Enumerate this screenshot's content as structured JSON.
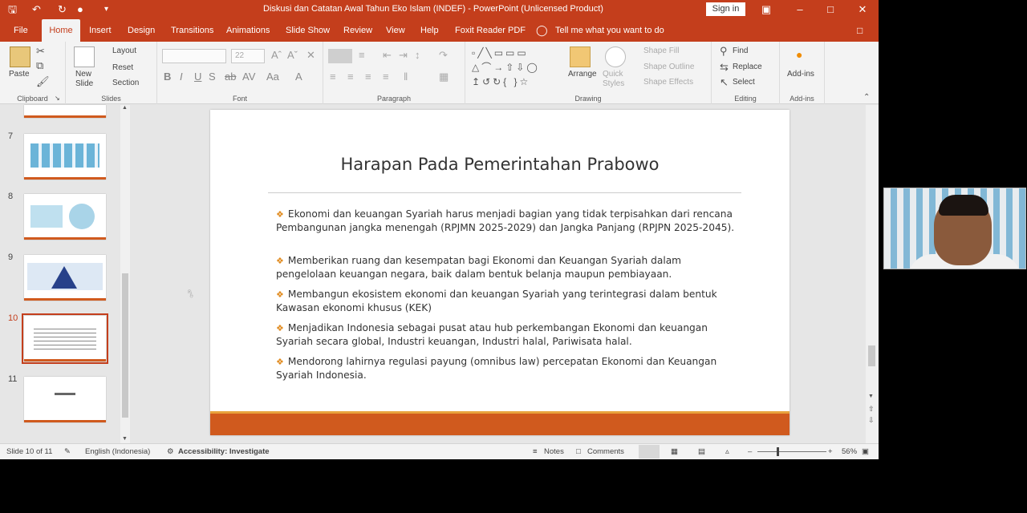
{
  "window": {
    "title": "Diskusi dan Catatan Awal Tahun Eko Islam (INDEF) - PowerPoint (Unlicensed Product)",
    "sign_in": "Sign in",
    "tell_me": "Tell me what you want to do"
  },
  "tabs": [
    "File",
    "Home",
    "Insert",
    "Design",
    "Transitions",
    "Animations",
    "Slide Show",
    "Review",
    "View",
    "Help",
    "Foxit Reader PDF"
  ],
  "ribbon": {
    "clipboard": {
      "label": "Clipboard",
      "paste": "Paste"
    },
    "slides": {
      "label": "Slides",
      "new_slide": "New Slide",
      "layout": "Layout",
      "reset": "Reset",
      "section": "Section"
    },
    "font": {
      "label": "Font",
      "size": "22"
    },
    "paragraph": {
      "label": "Paragraph"
    },
    "drawing": {
      "label": "Drawing",
      "arrange": "Arrange",
      "quick_styles": "Quick Styles",
      "shape_fill": "Shape Fill",
      "shape_outline": "Shape Outline",
      "shape_effects": "Shape Effects"
    },
    "editing": {
      "label": "Editing",
      "find": "Find",
      "replace": "Replace",
      "select": "Select"
    },
    "addins": {
      "label": "Add-ins",
      "button": "Add-ins"
    }
  },
  "thumbnails": [
    {
      "number": "7",
      "active": false
    },
    {
      "number": "8",
      "active": false
    },
    {
      "number": "9",
      "active": false
    },
    {
      "number": "10",
      "active": true
    },
    {
      "number": "11",
      "active": false
    }
  ],
  "slide": {
    "title": "Harapan Pada Pemerintahan Prabowo",
    "bullets": [
      "Ekonomi dan keuangan Syariah harus menjadi bagian yang tidak terpisahkan dari rencana Pembangunan jangka menengah (RPJMN 2025-2029) dan Jangka Panjang (RPJPN 2025-2045).",
      "Memberikan ruang dan kesempatan bagi Ekonomi dan Keuangan Syariah dalam pengelolaan keuangan negara, baik dalam bentuk belanja maupun pembiayaan.",
      "Membangun ekosistem ekonomi dan keuangan Syariah yang terintegrasi dalam bentuk Kawasan ekonomi khusus (KEK)",
      "Menjadikan Indonesia sebagai pusat atau hub perkembangan Ekonomi dan keuangan Syariah secara global, Industri keuangan, Industri halal, Pariwisata halal.",
      "Mendorong lahirnya regulasi payung (omnibus law) percepatan Ekonomi dan Keuangan Syariah Indonesia."
    ]
  },
  "status": {
    "slide_count": "Slide 10 of 11",
    "language": "English (Indonesia)",
    "accessibility": "Accessibility: Investigate",
    "notes": "Notes",
    "comments": "Comments",
    "zoom": "56%"
  },
  "colors": {
    "accent": "#c43e1c",
    "slide_footer": "#d05a1e",
    "bullet": "#e08a1e"
  }
}
